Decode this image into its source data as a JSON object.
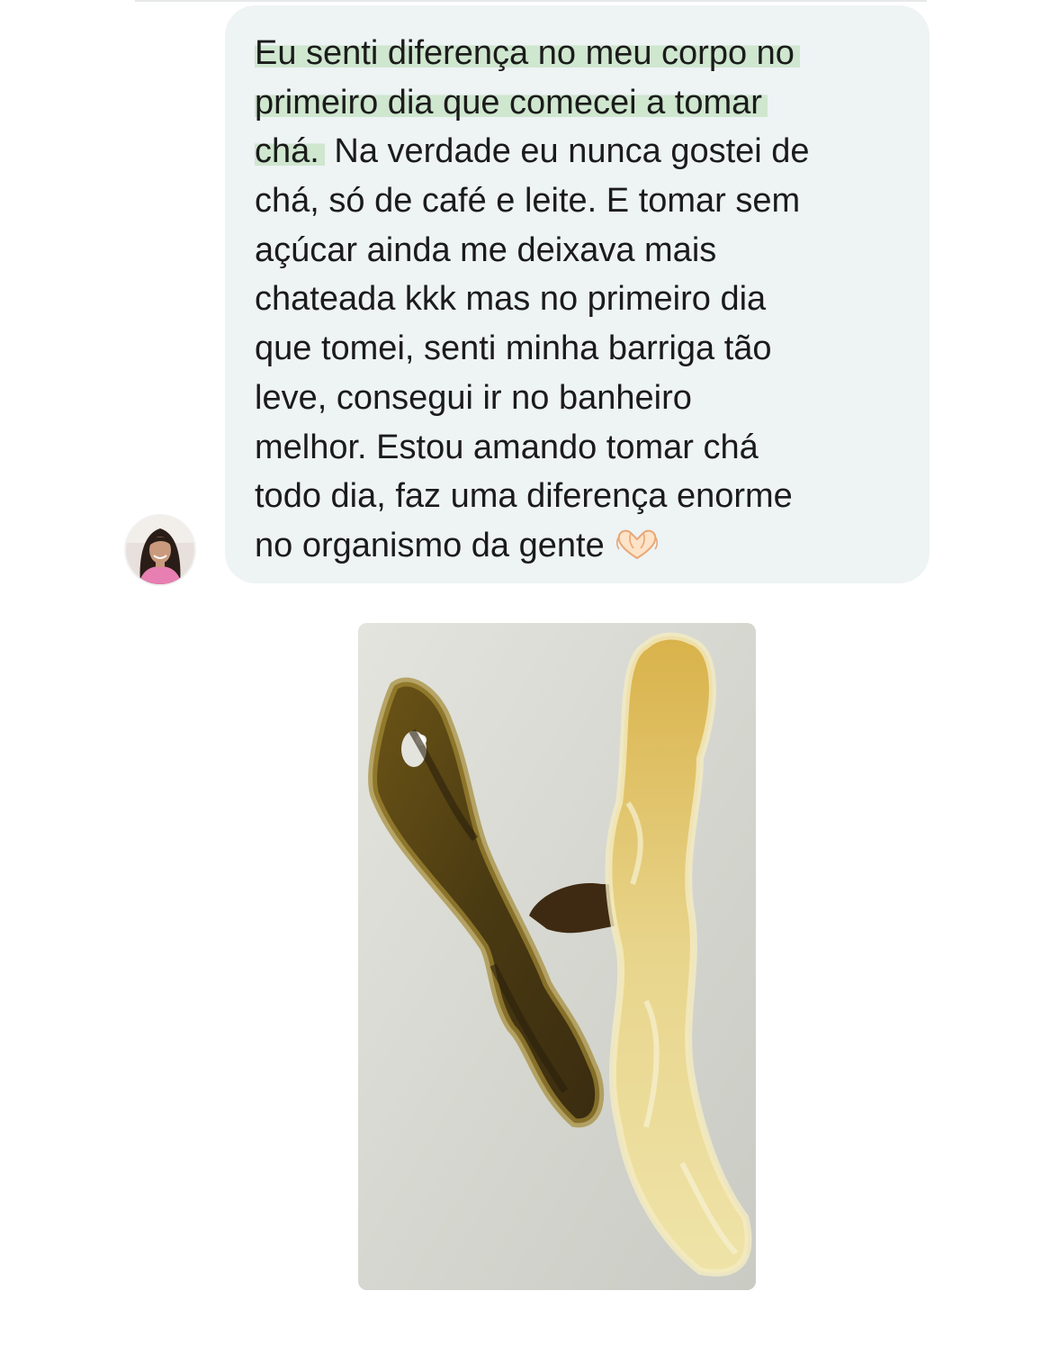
{
  "chat": {
    "message_lines": [
      "Eu senti diferença no meu corpo no",
      "primeiro dia que comecei a tomar",
      "chá.",
      " Na verdade eu nunca gostei de",
      "chá, só de café e leite. E tomar sem",
      "açúcar ainda me deixava mais",
      "chateada kkk mas no primeiro dia",
      "que tomei, senti minha barriga tão",
      "leve, consegui ir no banheiro",
      "melhor. Estou amando tomar chá",
      "todo dia, faz uma diferença enorme",
      "no organismo da gente"
    ],
    "emoji": "heart-hands-emoji",
    "highlight_color": "#cfe6cf",
    "bubble_color": "#eef3f4"
  },
  "sender": {
    "avatar": "profile-photo-woman"
  },
  "attachment": {
    "type": "photo"
  }
}
